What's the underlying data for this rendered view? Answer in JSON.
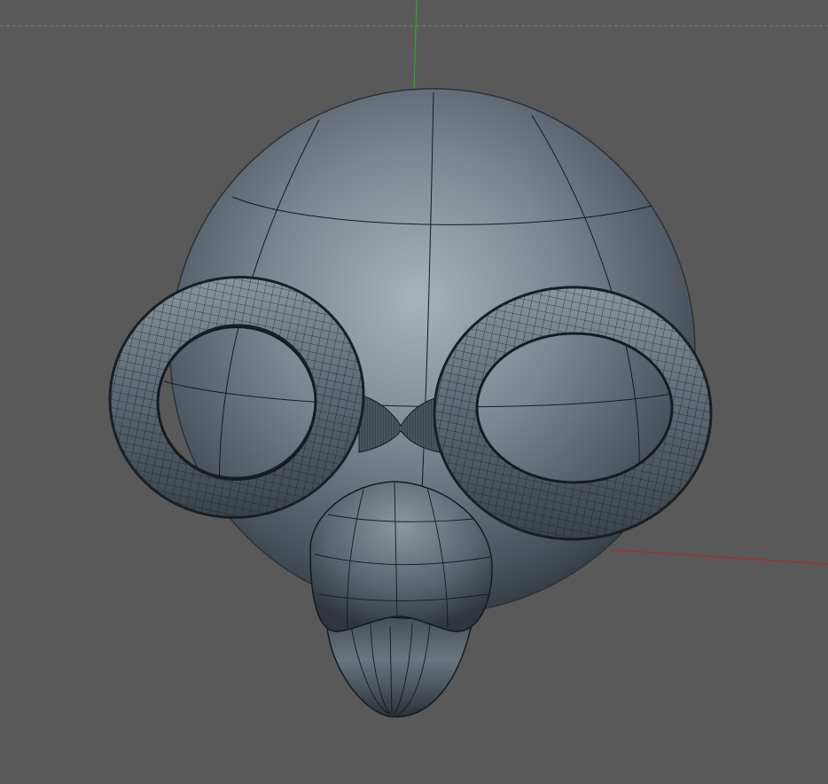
{
  "viewport": {
    "background_color": "#595959",
    "horizon_line_color": "#7a7a7a",
    "axis_colors": {
      "y_axis": "#2ea02e",
      "x_axis": "#b02a2a"
    },
    "model": {
      "name": "cartoon-head-with-goggles-and-beak",
      "surface_color": "#5a6470",
      "highlight_color": "#a9b2ba",
      "shadow_color": "#2c323a",
      "wire_color": "#151a20",
      "parts": [
        "head-sphere",
        "left-goggle-ring",
        "right-goggle-ring",
        "goggle-bridge",
        "beak"
      ]
    }
  }
}
